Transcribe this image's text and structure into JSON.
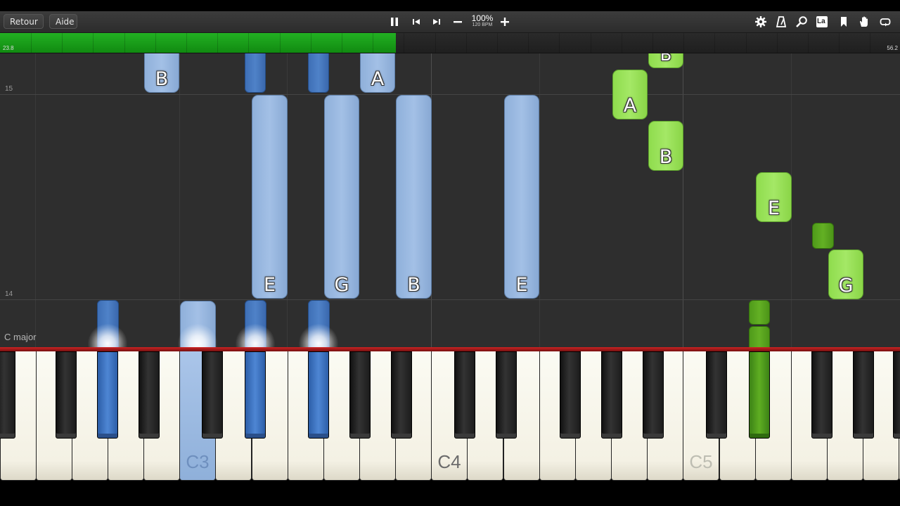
{
  "toolbar": {
    "back_label": "Retour",
    "help_label": "Aide",
    "zoom_level": "100%",
    "tempo": "120 BPM",
    "icons": {
      "transport": [
        "pause-icon",
        "previous-icon",
        "next-icon",
        "minus-icon",
        "plus-icon"
      ],
      "right": [
        "settings-gear-icon",
        "metronome-icon",
        "search-icon",
        "note-label-icon",
        "bookmark-icon",
        "hand-icon",
        "loop-icon"
      ]
    },
    "note_label_badge": "La"
  },
  "progress": {
    "fraction": 0.44,
    "start_label": "23.8",
    "end_label": "56.2",
    "color": "#1aa01a"
  },
  "roll": {
    "measure_labels": [
      "15",
      "14"
    ],
    "key_signature": "C major",
    "note_letters": {
      "b_top_left": "B",
      "a_top": "A",
      "e_lower_1": "E",
      "g_lower": "G",
      "b_lower": "B",
      "e_lower_2": "E",
      "b_top_right": "B",
      "a_green": "A",
      "b_green": "B",
      "e_green": "E",
      "g_green": "G"
    },
    "colors": {
      "left_hand_light": "#98b7e0",
      "left_hand_dark": "#4579c0",
      "right_hand_light": "#9ae25a",
      "right_hand_dark": "#58a51e"
    }
  },
  "keyboard": {
    "octave_labels": [
      "C3",
      "C4",
      "C5"
    ],
    "bar_color": "#b01818"
  }
}
